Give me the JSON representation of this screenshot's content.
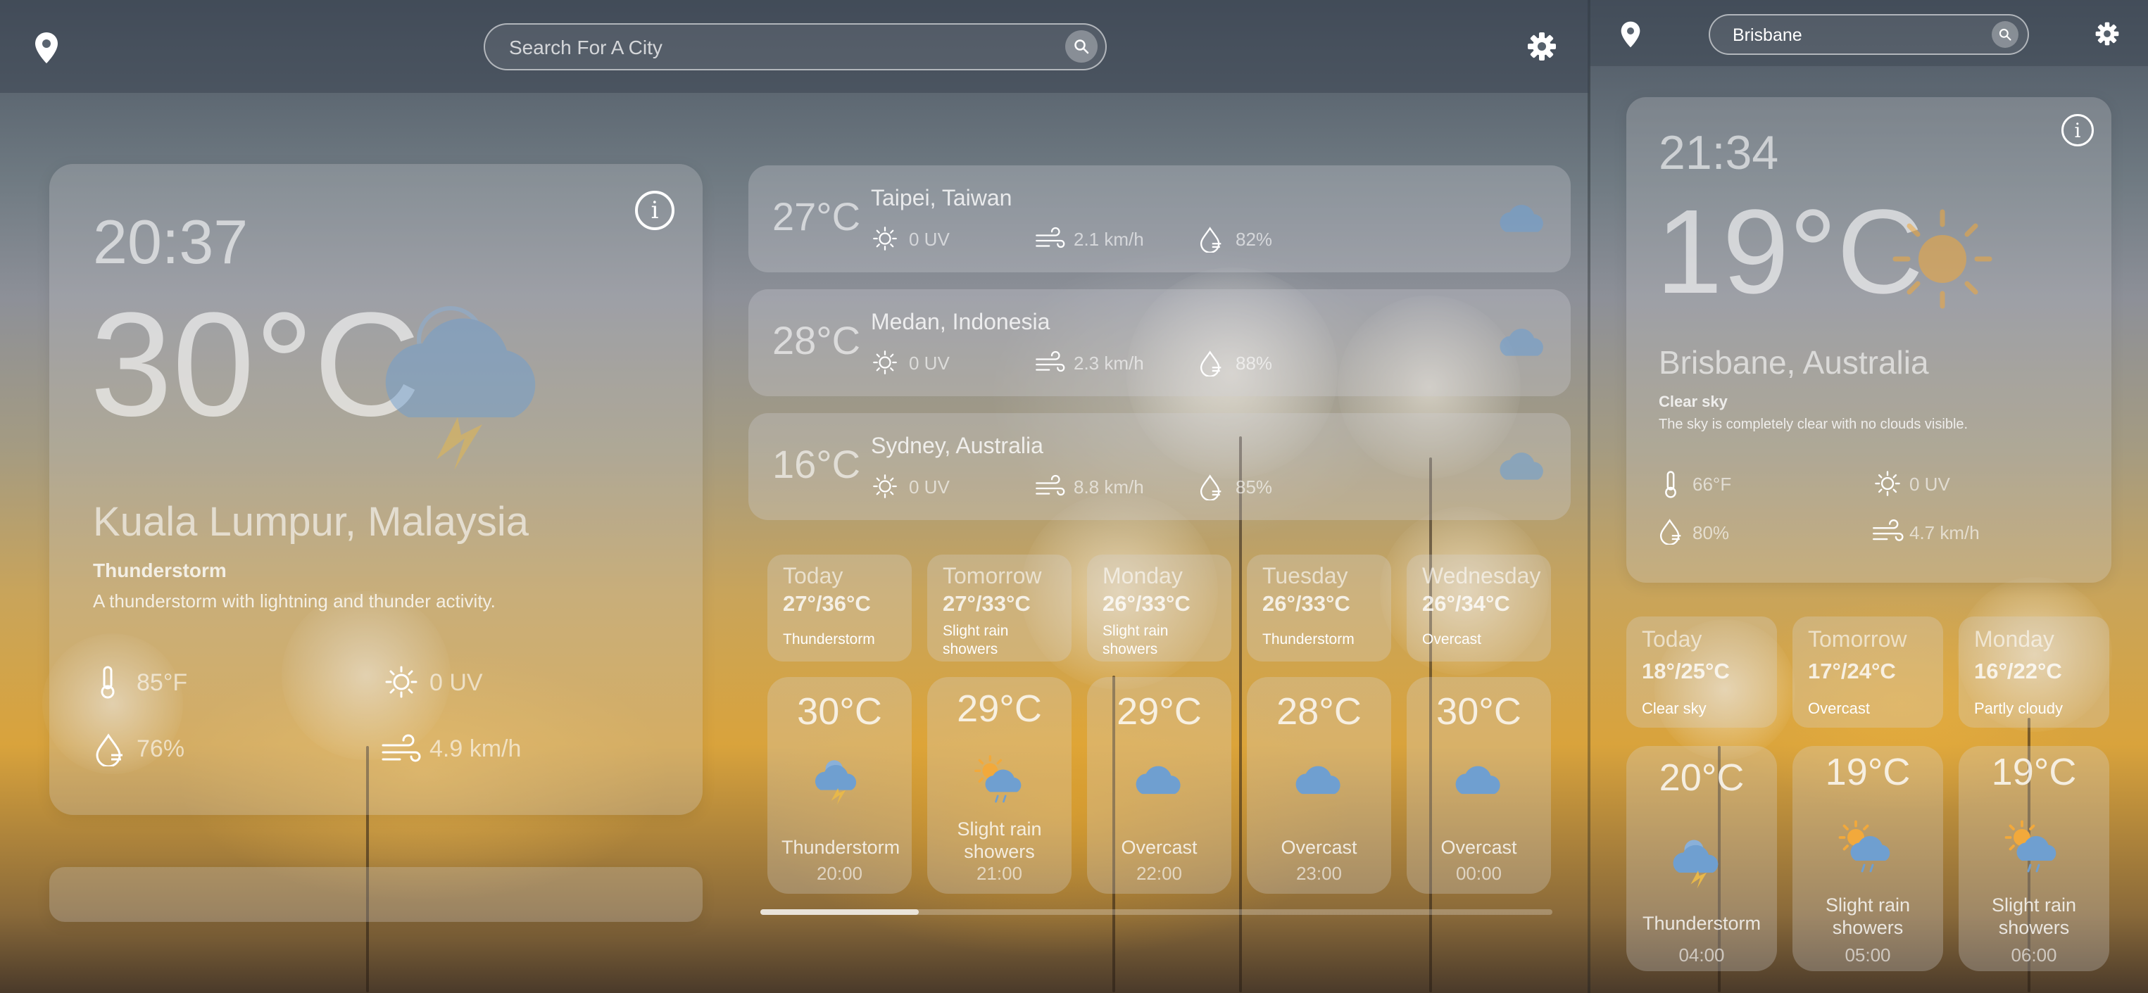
{
  "left": {
    "search_placeholder": "Search For A City",
    "main": {
      "time": "20:37",
      "temp": "30°C",
      "city": "Kuala Lumpur, Malaysia",
      "condition": "Thunderstorm",
      "description": "A thunderstorm with lightning and thunder activity.",
      "fahrenheit": "85°F",
      "uv": "0 UV",
      "humidity": "76%",
      "wind": "4.9 km/h",
      "info_label": "i"
    },
    "cities": [
      {
        "temp": "27°C",
        "name": "Taipei, Taiwan",
        "uv": "0 UV",
        "wind": "2.1 km/h",
        "humidity": "82%"
      },
      {
        "temp": "28°C",
        "name": "Medan, Indonesia",
        "uv": "0 UV",
        "wind": "2.3 km/h",
        "humidity": "88%"
      },
      {
        "temp": "16°C",
        "name": "Sydney, Australia",
        "uv": "0 UV",
        "wind": "8.8 km/h",
        "humidity": "85%"
      }
    ],
    "forecast": [
      {
        "day": "Today",
        "range": "27°/36°C",
        "cond": "Thunderstorm"
      },
      {
        "day": "Tomorrow",
        "range": "27°/33°C",
        "cond": "Slight rain showers"
      },
      {
        "day": "Monday",
        "range": "26°/33°C",
        "cond": "Slight rain showers"
      },
      {
        "day": "Tuesday",
        "range": "26°/33°C",
        "cond": "Thunderstorm"
      },
      {
        "day": "Wednesday",
        "range": "26°/34°C",
        "cond": "Overcast"
      }
    ],
    "hourly": [
      {
        "temp": "30°C",
        "cond": "Thunderstorm",
        "time": "20:00",
        "icon": "thunder-cloud"
      },
      {
        "temp": "29°C",
        "cond": "Slight rain showers",
        "time": "21:00",
        "icon": "sun-rain-cloud"
      },
      {
        "temp": "29°C",
        "cond": "Overcast",
        "time": "22:00",
        "icon": "cloud"
      },
      {
        "temp": "28°C",
        "cond": "Overcast",
        "time": "23:00",
        "icon": "cloud"
      },
      {
        "temp": "30°C",
        "cond": "Overcast",
        "time": "00:00",
        "icon": "cloud"
      }
    ],
    "scroll_progress": 0.2
  },
  "right": {
    "search_value": "Brisbane",
    "main": {
      "time": "21:34",
      "temp": "19°C",
      "city": "Brisbane, Australia",
      "condition": "Clear sky",
      "description": "The sky is completely clear with no clouds visible.",
      "fahrenheit": "66°F",
      "uv": "0 UV",
      "humidity": "80%",
      "wind": "4.7 km/h",
      "info_label": "i"
    },
    "forecast": [
      {
        "day": "Today",
        "range": "18°/25°C",
        "cond": "Clear sky"
      },
      {
        "day": "Tomorrow",
        "range": "17°/24°C",
        "cond": "Overcast"
      },
      {
        "day": "Monday",
        "range": "16°/22°C",
        "cond": "Partly cloudy"
      }
    ],
    "hourly": [
      {
        "temp": "20°C",
        "cond": "Thunderstorm",
        "time": "04:00",
        "icon": "thunder-cloud"
      },
      {
        "temp": "19°C",
        "cond": "Slight rain showers",
        "time": "05:00",
        "icon": "sun-rain-cloud"
      },
      {
        "temp": "19°C",
        "cond": "Slight rain showers",
        "time": "06:00",
        "icon": "sun-rain-cloud"
      }
    ]
  },
  "colors": {
    "accent_cloud": "#6f9fd0",
    "sun": "#f2a93b",
    "lightning": "#e8b84a"
  }
}
